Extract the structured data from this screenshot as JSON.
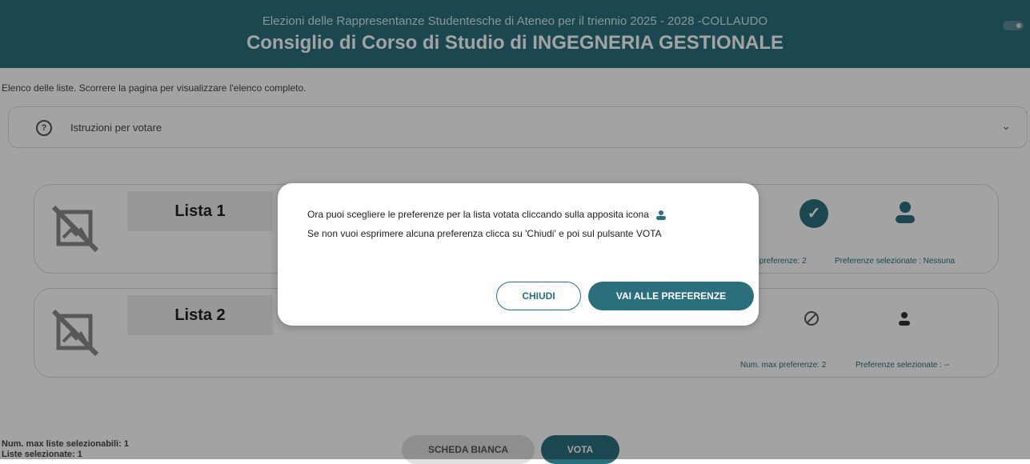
{
  "header": {
    "subtitle": "Elezioni delle Rappresentanze Studentesche di Ateneo per il triennio 2025 - 2028 -COLLAUDO",
    "title": "Consiglio di Corso di Studio di INGEGNERIA GESTIONALE"
  },
  "intro_text": "Elenco delle liste. Scorrere la pagina per visualizzare l'elenco completo.",
  "instructions": {
    "label": "Istruzioni per votare"
  },
  "lists": [
    {
      "name": "Lista 1",
      "max_pref": "x preferenze: 2",
      "selected_pref": "Preferenze selezionate : Nessuna"
    },
    {
      "name": "Lista 2",
      "max_pref": "Num. max preferenze: 2",
      "selected_pref": "Preferenze selezionate : --"
    }
  ],
  "footer": {
    "max_lists": "Num. max liste selezionabili: 1",
    "selected_lists": "Liste selezionate: 1",
    "blank_button": "SCHEDA BIANCA",
    "vote_button": "VOTA"
  },
  "modal": {
    "line1": "Ora puoi scegliere le preferenze per la lista votata cliccando sulla apposita icona",
    "line2": "Se non vuoi esprimere alcuna preferenza clicca su 'Chiudi' e poi sul pulsante VOTA",
    "close_button": "CHIUDI",
    "go_button": "VAI ALLE PREFERENZE"
  },
  "colors": {
    "accent": "#2b6f7d"
  }
}
